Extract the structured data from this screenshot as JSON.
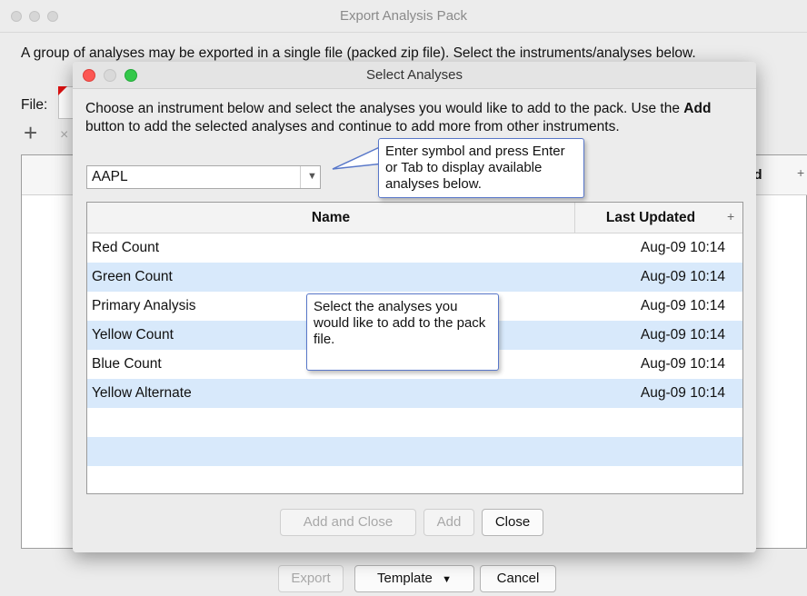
{
  "outer": {
    "title": "Export Analysis Pack",
    "description": "A group of analyses may be exported in a single file (packed zip file). Select the instruments/analyses below.",
    "file_label": "File:",
    "add_symbol": "+",
    "remove_symbol": "×",
    "table_col_fragment": "ted",
    "table_plus": "+",
    "buttons": {
      "export": "Export",
      "template": "Template",
      "cancel": "Cancel"
    }
  },
  "dialog": {
    "title": "Select Analyses",
    "desc_before": "Choose an instrument below and select the analyses you would like to add to the pack.  Use the ",
    "desc_bold": "Add",
    "desc_after": " button to add the selected analyses and continue to add more from other instruments.",
    "symbol_value": "AAPL",
    "columns": {
      "name": "Name",
      "last_updated": "Last Updated",
      "plus": "+"
    },
    "rows": [
      {
        "name": "Red Count",
        "last_updated": "Aug-09 10:14"
      },
      {
        "name": "Green Count",
        "last_updated": "Aug-09 10:14"
      },
      {
        "name": "Primary Analysis",
        "last_updated": "Aug-09 10:14"
      },
      {
        "name": "Yellow Count",
        "last_updated": "Aug-09 10:14"
      },
      {
        "name": "Blue Count",
        "last_updated": "Aug-09 10:14"
      },
      {
        "name": "Yellow Alternate",
        "last_updated": "Aug-09 10:14"
      }
    ],
    "buttons": {
      "add_and_close": "Add and Close",
      "add": "Add",
      "close": "Close"
    }
  },
  "callouts": {
    "symbol_hint": "Enter symbol and press Enter or Tab to display available analyses below.",
    "select_hint": "Select the analyses you would like to add to the pack file."
  },
  "colors": {
    "selected_row": "#d8e9fb",
    "callout_border": "#5877c9",
    "close_light": "#fc5753",
    "minimize_light": "#d9d9d9",
    "zoom_light": "#34c84a"
  },
  "icons": [
    "dropdown-arrow-icon",
    "add-icon",
    "remove-icon",
    "dropdown-chevron-icon"
  ]
}
